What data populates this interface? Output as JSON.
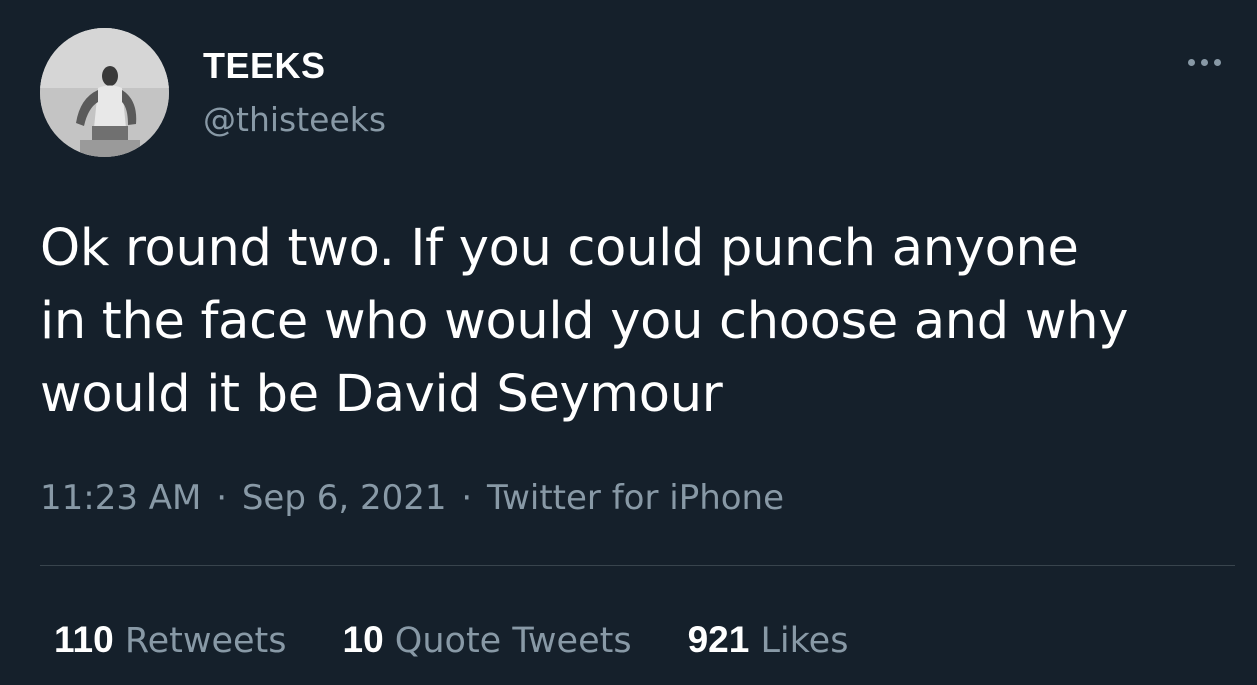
{
  "user": {
    "display_name": "TEEKS",
    "handle": "@thisteeks",
    "avatar_icon": "profile-photo"
  },
  "tweet": {
    "text": "Ok round two. If you could punch anyone\nin the face who would you choose and why\nwould it be David Seymour",
    "time": "11:23 AM",
    "separator": "·",
    "date": "Sep 6, 2021",
    "source": "Twitter for iPhone"
  },
  "stats": {
    "retweets_count": "110",
    "retweets_label": "Retweets",
    "quotes_count": "10",
    "quotes_label": "Quote Tweets",
    "likes_count": "921",
    "likes_label": "Likes"
  },
  "colors": {
    "background": "#15202b",
    "secondary_text": "#8899a6",
    "divider": "#38444d"
  }
}
